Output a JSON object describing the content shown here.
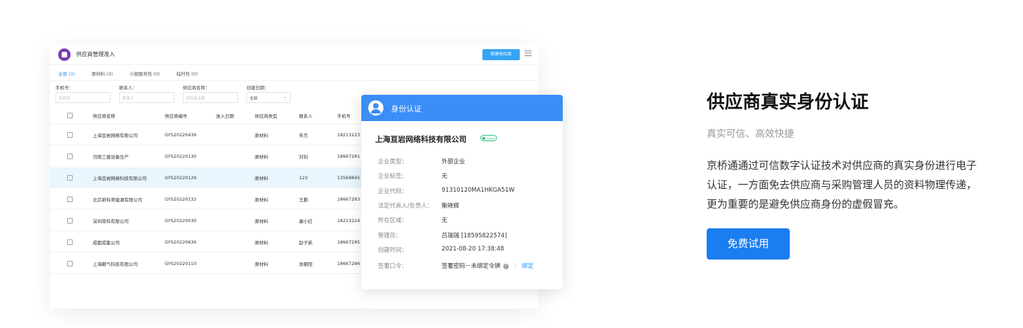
{
  "admin": {
    "title": "供应商管理准入",
    "new_button": "新建供应商",
    "tabs": [
      "全部 (3)",
      "原材料 (3)",
      "小额服务性 (0)",
      "临时性 (0)"
    ],
    "filters": {
      "phone_label": "手机号：",
      "contact_label": "联系人：",
      "supplier_name_label": "供应商名称：",
      "created_label": "创建日期：",
      "phone_placeholder": "手机号",
      "contact_placeholder": "联系人",
      "supplier_name_placeholder": "供应商名称",
      "created_value": "全部"
    },
    "columns": [
      "供应商名称",
      "供应商编号",
      "准入日期",
      "供应商类型",
      "联系人",
      "手机号"
    ],
    "rows": [
      {
        "name": "上海亘岩网络有限公司",
        "code": "GYS20220436",
        "type": "原材料",
        "contact": "朱杰",
        "phone": "18213223"
      },
      {
        "name": "河南三建设备生产",
        "code": "GYS20220130",
        "type": "原材料",
        "contact": "刘钊",
        "phone": "18667281"
      },
      {
        "name": "上海亘岩网络科技有限公司",
        "code": "GYS20220129",
        "type": "原材料",
        "contact": "123",
        "phone": "13569845"
      },
      {
        "name": "北京新科美能源有限公司",
        "code": "GYS20220132",
        "type": "原材料",
        "contact": "王鹏",
        "phone": "18667283"
      },
      {
        "name": "深圳荣科有限公司",
        "code": "GYS20220030",
        "type": "原材料",
        "contact": "康小红",
        "phone": "18213224"
      },
      {
        "name": "成都成集公司",
        "code": "GYS20220636",
        "type": "原材料",
        "contact": "赵子新",
        "phone": "18667285"
      },
      {
        "name": "上海朝气科技有限公司",
        "code": "GYS20220110",
        "type": "原材料",
        "contact": "张朝阳",
        "phone": "18667286"
      }
    ],
    "highlighted_row": 2
  },
  "card": {
    "title": "身份认证",
    "company": "上海亘岩网络科技有限公司",
    "fields": [
      {
        "k": "企业类型：",
        "v": "外部企业"
      },
      {
        "k": "企业标签：",
        "v": "无"
      },
      {
        "k": "企业代码：",
        "v": "91310120MA1HKGA51W"
      },
      {
        "k": "法定代表人/负责人：",
        "v": "衡晓辉"
      },
      {
        "k": "所在区域：",
        "v": "无"
      },
      {
        "k": "管理员：",
        "v": "吕瑞瑞 [18595822574]"
      },
      {
        "k": "创建时间：",
        "v": "2021-08-20 17:38:48"
      }
    ],
    "token_label": "签署口令：",
    "token_value": "签署密码－未绑定令牌",
    "token_help": "?",
    "token_sep": "|",
    "token_link": "绑定"
  },
  "promo": {
    "headline": "供应商真实身份认证",
    "subline": "真实可信、高效快捷",
    "description": "京桥通通过可信数字认证技术对供应商的真实身份进行电子认证，一方面免去供应商与采购管理人员的资料物理传递，更为重要的是避免供应商身份的虚假冒充。",
    "cta": "免费试用"
  },
  "colors": {
    "accent": "#1a7df0",
    "card_header": "#3a8ef6",
    "row_highlight": "#eaf6fd",
    "logo": "#7b3fb4"
  }
}
